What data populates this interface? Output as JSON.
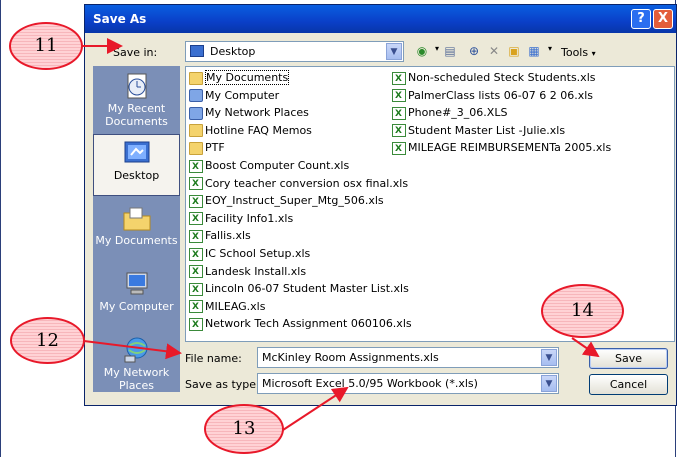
{
  "dialog": {
    "title": "Save As",
    "help_label": "?",
    "close_label": "X",
    "save_in_label": "Save in:",
    "save_in_value": "Desktop",
    "tools_label": "Tools",
    "file_name_label": "File name:",
    "file_name_value": "McKinley Room Assignments.xls",
    "save_as_type_label": "Save as type:",
    "save_as_type_value": "Microsoft Excel 5.0/95 Workbook (*.xls)",
    "save_button": "Save",
    "cancel_button": "Cancel"
  },
  "places": [
    {
      "label": "My Recent Documents",
      "icon": "recent-documents-icon"
    },
    {
      "label": "Desktop",
      "icon": "desktop-icon"
    },
    {
      "label": "My Documents",
      "icon": "my-documents-icon"
    },
    {
      "label": "My Computer",
      "icon": "my-computer-icon"
    },
    {
      "label": "My Network Places",
      "icon": "network-places-icon"
    }
  ],
  "files_col1": [
    {
      "name": "My Documents",
      "kind": "folder"
    },
    {
      "name": "My Computer",
      "kind": "sys"
    },
    {
      "name": "My Network Places",
      "kind": "sys"
    },
    {
      "name": "Hotline FAQ Memos",
      "kind": "folder"
    },
    {
      "name": "PTF",
      "kind": "folder"
    },
    {
      "name": "Boost Computer Count.xls",
      "kind": "xls"
    },
    {
      "name": "Cory teacher conversion osx final.xls",
      "kind": "xls"
    },
    {
      "name": "EOY_Instruct_Super_Mtg_506.xls",
      "kind": "xls"
    },
    {
      "name": "Facility Info1.xls",
      "kind": "xls"
    },
    {
      "name": "Fallis.xls",
      "kind": "xls"
    },
    {
      "name": "IC School Setup.xls",
      "kind": "xls"
    },
    {
      "name": "Landesk Install.xls",
      "kind": "xls"
    },
    {
      "name": "Lincoln 06-07 Student Master List.xls",
      "kind": "xls"
    },
    {
      "name": "MILEAG.xls",
      "kind": "xls"
    },
    {
      "name": "Network Tech Assignment 060106.xls",
      "kind": "xls"
    }
  ],
  "files_col2": [
    {
      "name": "Non-scheduled Steck Students.xls",
      "kind": "xls"
    },
    {
      "name": "PalmerClass lists 06-07 6 2 06.xls",
      "kind": "xls"
    },
    {
      "name": "Phone#_3_06.XLS",
      "kind": "xls"
    },
    {
      "name": "Student Master List -Julie.xls",
      "kind": "xls"
    },
    {
      "name": "MILEAGE REIMBURSEMENTa 2005.xls",
      "kind": "xls"
    }
  ],
  "annotations": [
    "11",
    "12",
    "13",
    "14"
  ],
  "colors": {
    "title_bar": "#0a4fd8",
    "annotation_stroke": "#e8192a",
    "places_bar": "#7b8fb7"
  }
}
